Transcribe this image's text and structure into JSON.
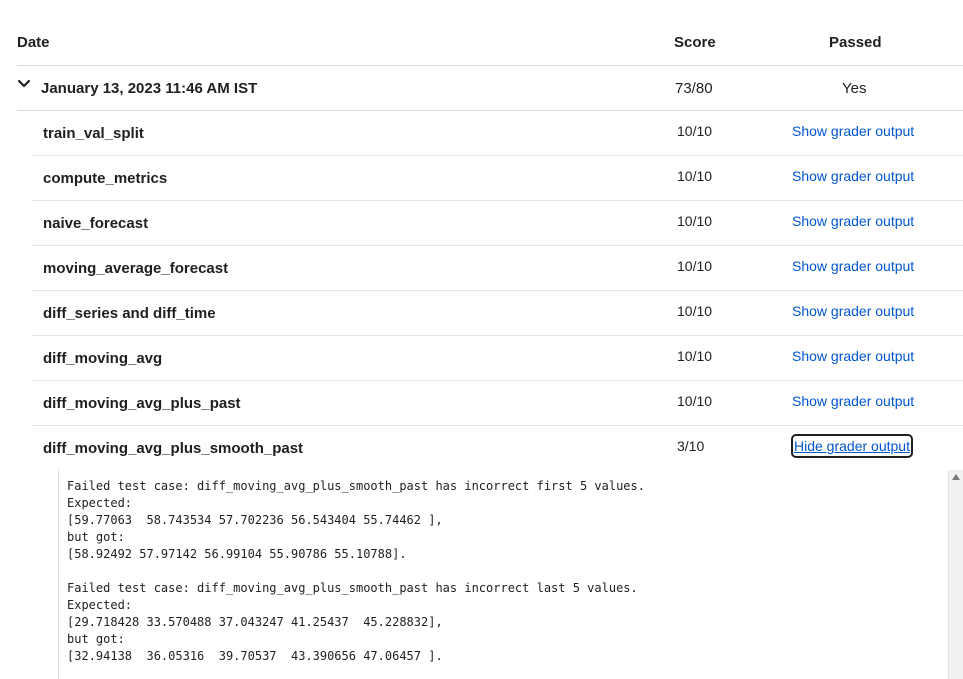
{
  "header": {
    "date": "Date",
    "score": "Score",
    "passed": "Passed"
  },
  "submission": {
    "date": "January 13, 2023 11:46 AM IST",
    "score": "73/80",
    "passed": "Yes",
    "icon": "chevron-down-icon"
  },
  "rows": [
    {
      "name": "train_val_split",
      "score": "10/10",
      "action": "Show grader output"
    },
    {
      "name": "compute_metrics",
      "score": "10/10",
      "action": "Show grader output"
    },
    {
      "name": "naive_forecast",
      "score": "10/10",
      "action": "Show grader output"
    },
    {
      "name": "moving_average_forecast",
      "score": "10/10",
      "action": "Show grader output"
    },
    {
      "name": "diff_series and diff_time",
      "score": "10/10",
      "action": "Show grader output"
    },
    {
      "name": "diff_moving_avg",
      "score": "10/10",
      "action": "Show grader output"
    },
    {
      "name": "diff_moving_avg_plus_past",
      "score": "10/10",
      "action": "Show grader output"
    },
    {
      "name": "diff_moving_avg_plus_smooth_past",
      "score": "3/10",
      "action": "Hide grader output"
    }
  ],
  "grader_output": "Failed test case: diff_moving_avg_plus_smooth_past has incorrect first 5 values.\nExpected:\n[59.77063  58.743534 57.702236 56.543404 55.74462 ],\nbut got:\n[58.92492 57.97142 56.99104 55.90786 55.10788].\n\nFailed test case: diff_moving_avg_plus_smooth_past has incorrect last 5 values.\nExpected:\n[29.718428 33.570488 37.043247 41.25437  45.228832],\nbut got:\n[32.94138  36.05316  39.70537  43.390656 47.06457 ].",
  "colors": {
    "link": "#0056d2",
    "border": "#d9d9d9"
  }
}
